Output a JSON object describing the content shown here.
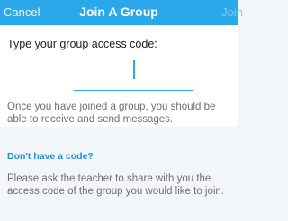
{
  "navbar": {
    "cancel_label": "Cancel",
    "title": "Join A Group",
    "join_label": "Join"
  },
  "form": {
    "prompt": "Type your group access code:",
    "code_value": "",
    "info": "Once you have joined a group, you should be able to receive and send messages."
  },
  "help": {
    "title": "Don't have a code?",
    "text": "Please ask the teacher to share with you the access code of the group you would like to join."
  },
  "colors": {
    "accent": "#2aa8e9",
    "link": "#1f8fd6",
    "background": "#f2f6f9"
  }
}
